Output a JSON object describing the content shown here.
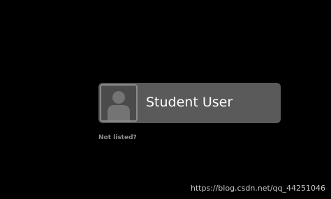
{
  "user_list": {
    "users": [
      {
        "name": "Student User",
        "avatar_icon": "default-user-avatar-icon"
      }
    ],
    "not_listed_label": "Not listed?"
  },
  "watermark": "https://blog.csdn.net/qq_44251046",
  "colors": {
    "background": "#000000",
    "card": "#5a5a5a",
    "avatar_border": "#8a8a8a",
    "name_text": "#ffffff",
    "link_text": "#8e8e8e"
  }
}
